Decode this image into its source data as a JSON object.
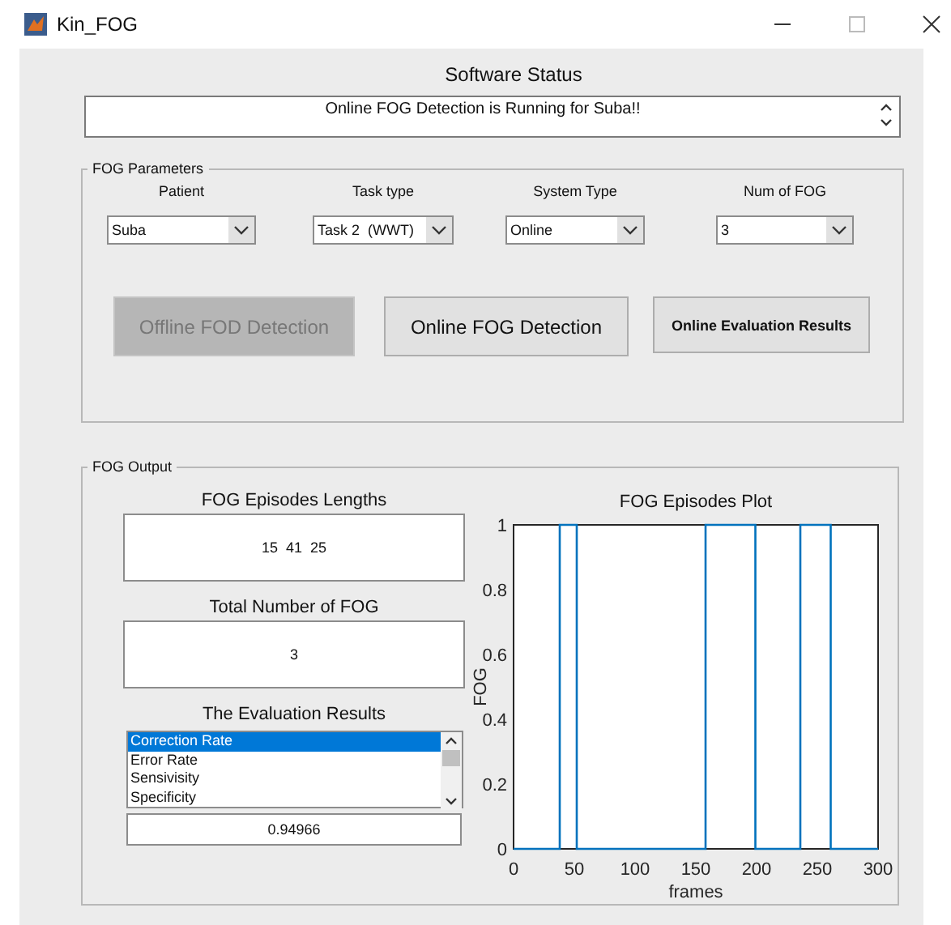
{
  "window": {
    "title": "Kin_FOG"
  },
  "software_status": {
    "title": "Software Status",
    "message": "Online FOG Detection is Running for Suba!!"
  },
  "fog_parameters": {
    "title": "FOG Parameters",
    "fields": [
      {
        "label": "Patient",
        "value": "Suba"
      },
      {
        "label": "Task type",
        "value": "Task 2  (WWT)"
      },
      {
        "label": "System Type",
        "value": "Online"
      },
      {
        "label": "Num of FOG",
        "value": "3"
      }
    ],
    "buttons": [
      {
        "label": "Offline FOD Detection",
        "disabled": true
      },
      {
        "label": "Online FOG Detection",
        "disabled": false
      },
      {
        "label": "Online Evaluation Results",
        "disabled": false
      }
    ]
  },
  "fog_output": {
    "title": "FOG Output",
    "episodes_lengths": {
      "title": "FOG Episodes Lengths",
      "value": "15  41  25"
    },
    "total": {
      "title": "Total Number of FOG",
      "value": "3"
    },
    "evaluation": {
      "title": "The Evaluation Results",
      "items": [
        {
          "label": "Correction Rate",
          "selected": true
        },
        {
          "label": "Error Rate",
          "selected": false
        },
        {
          "label": "Sensivisity",
          "selected": false
        },
        {
          "label": "Specificity",
          "selected": false
        }
      ],
      "value": "0.94966"
    },
    "plot": {
      "chart_data": {
        "type": "line",
        "title": "FOG Episodes Plot",
        "xlabel": "frames",
        "ylabel": "FOG",
        "x": [
          0,
          38,
          38,
          52,
          52,
          158,
          158,
          199,
          199,
          236,
          236,
          261,
          261,
          300
        ],
        "series": [
          {
            "color": "#0072bd",
            "values": [
              0,
              0,
              1,
              1,
              0,
              0,
              1,
              1,
              0,
              0,
              1,
              1,
              0,
              0
            ]
          }
        ],
        "xlim": [
          0,
          300
        ],
        "ylim": [
          0,
          1
        ],
        "xticks": [
          0,
          50,
          100,
          150,
          200,
          250,
          300
        ],
        "yticks": [
          0,
          0.2,
          0.4,
          0.6,
          0.8,
          1
        ]
      }
    }
  }
}
